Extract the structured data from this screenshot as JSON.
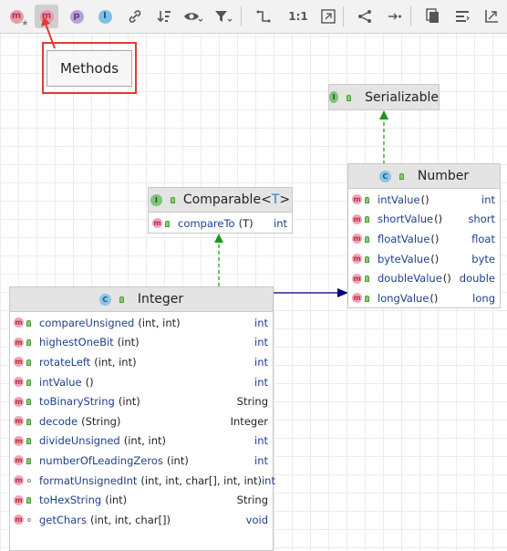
{
  "toolbar": {
    "buttons": [
      {
        "id": "fields",
        "glyph": "m",
        "icon": "fields-star-icon",
        "color": "#e89aa8"
      },
      {
        "id": "methods",
        "glyph": "m",
        "icon": "methods-icon",
        "color": "#e89aa8",
        "active": true
      },
      {
        "id": "properties",
        "glyph": "p",
        "icon": "properties-icon",
        "color": "#b9a0d8"
      },
      {
        "id": "inner",
        "glyph": "I",
        "icon": "inner-classes-icon",
        "color": "#7fbfe8"
      },
      {
        "id": "edge",
        "glyph": "",
        "icon": "link-icon"
      },
      {
        "id": "sort",
        "glyph": "",
        "icon": "sort-icon"
      },
      {
        "id": "visibility",
        "glyph": "",
        "icon": "eye-icon"
      },
      {
        "id": "filter",
        "glyph": "",
        "icon": "filter-icon"
      },
      {
        "id": "route",
        "glyph": "",
        "icon": "route-edges-icon"
      },
      {
        "id": "actual",
        "glyph": "1:1",
        "icon": "actual-size-icon"
      },
      {
        "id": "fit",
        "glyph": "",
        "icon": "fit-content-icon"
      },
      {
        "id": "share",
        "glyph": "",
        "icon": "share-icon"
      },
      {
        "id": "export",
        "glyph": "",
        "icon": "export-icon"
      },
      {
        "id": "copy",
        "glyph": "",
        "icon": "copy-icon"
      },
      {
        "id": "align",
        "glyph": "",
        "icon": "align-icon"
      },
      {
        "id": "layout",
        "glyph": "",
        "icon": "layout-icon"
      }
    ]
  },
  "tooltip": {
    "text": "Methods"
  },
  "colors": {
    "highlight": "#e53935",
    "implements_edge": "#1a9a1a",
    "extends_edge": "#000080",
    "header_bg": "#e4e4e4"
  },
  "nodes": {
    "serializable": {
      "title": "Serializable",
      "kind": "interface"
    },
    "comparable": {
      "title": "Comparable",
      "type_param_open": "<",
      "type_param": "T",
      "type_param_close": ">",
      "kind": "interface",
      "rows": [
        {
          "name": "compareTo",
          "params": "(T)",
          "type": "int",
          "visibility": "public"
        }
      ]
    },
    "number": {
      "title": "Number",
      "kind": "class",
      "rows": [
        {
          "name": "intValue",
          "params": "()",
          "type": "int",
          "visibility": "public"
        },
        {
          "name": "shortValue",
          "params": "()",
          "type": "short",
          "visibility": "public"
        },
        {
          "name": "floatValue",
          "params": "()",
          "type": "float",
          "visibility": "public"
        },
        {
          "name": "byteValue",
          "params": "()",
          "type": "byte",
          "visibility": "public"
        },
        {
          "name": "doubleValue",
          "params": "()",
          "type": "double",
          "visibility": "public"
        },
        {
          "name": "longValue",
          "params": "()",
          "type": "long",
          "visibility": "public"
        }
      ]
    },
    "integer": {
      "title": "Integer",
      "kind": "class",
      "rows": [
        {
          "name": "compareUnsigned",
          "params": "(int, int)",
          "type": "int",
          "visibility": "public"
        },
        {
          "name": "highestOneBit",
          "params": "(int)",
          "type": "int",
          "visibility": "public"
        },
        {
          "name": "rotateLeft",
          "params": "(int, int)",
          "type": "int",
          "visibility": "public"
        },
        {
          "name": "intValue",
          "params": "()",
          "type": "int",
          "visibility": "public"
        },
        {
          "name": "toBinaryString",
          "params": "(int)",
          "type": "String",
          "visibility": "public"
        },
        {
          "name": "decode",
          "params": "(String)",
          "type": "Integer",
          "visibility": "public"
        },
        {
          "name": "divideUnsigned",
          "params": "(int, int)",
          "type": "int",
          "visibility": "public"
        },
        {
          "name": "numberOfLeadingZeros",
          "params": "(int)",
          "type": "int",
          "visibility": "public"
        },
        {
          "name": "formatUnsignedInt",
          "params": "(int, int, char[], int, int)",
          "type": "int",
          "visibility": "package"
        },
        {
          "name": "toHexString",
          "params": "(int)",
          "type": "String",
          "visibility": "public"
        },
        {
          "name": "getChars",
          "params": "(int, int, char[])",
          "type": "void",
          "visibility": "package"
        }
      ]
    }
  }
}
